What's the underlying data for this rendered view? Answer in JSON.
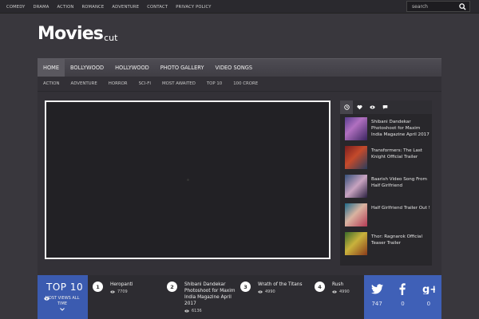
{
  "topnav": [
    "COMEDY",
    "DRAMA",
    "ACTION",
    "ROMANCE",
    "ADVENTURE",
    "CONTACT",
    "PRIVACY POLICY"
  ],
  "search": {
    "placeholder": "search"
  },
  "logo": {
    "main": "Movies",
    "sub": "cut"
  },
  "mainnav": [
    "HOME",
    "BOLLYWOOD",
    "HOLLYWOOD",
    "PHOTO GALLERY",
    "VIDEO SONGS"
  ],
  "subnav": [
    "ACTION",
    "ADVENTURE",
    "HORROR",
    "SCI-FI",
    "MOST AWAITED",
    "TOP 10",
    "100 CRORE"
  ],
  "sidebar": {
    "tabs": [
      "clock-icon",
      "heart-icon",
      "eye-icon",
      "comment-icon"
    ],
    "posts": [
      {
        "title": "Shibani Dandekar Photoshoot for Maxim India Magazine April 2017"
      },
      {
        "title": "Transformers: The Last Knight Official Trailer"
      },
      {
        "title": "Baarish Video Song From Half Girlfriend"
      },
      {
        "title": "Half Girlfriend Trailer Out !"
      },
      {
        "title": "Thor: Ragnarok Official Teaser Trailer"
      }
    ]
  },
  "top10": {
    "title": "TOP 10",
    "subtitle": "MOST VIEWS ALL TIME",
    "items": [
      {
        "rank": "1",
        "title": "Heropanti",
        "views": "7709"
      },
      {
        "rank": "2",
        "title": "Shibani Dandekar Photoshoot for Maxim India Magazine April 2017",
        "views": "6136"
      },
      {
        "rank": "3",
        "title": "Wrath of the Titans",
        "views": "4990"
      },
      {
        "rank": "4",
        "title": "Rush",
        "views": "4990"
      }
    ]
  },
  "social": [
    {
      "icon": "twitter-icon",
      "count": "747"
    },
    {
      "icon": "facebook-icon",
      "count": "0"
    },
    {
      "icon": "google-plus-icon",
      "count": "0"
    }
  ],
  "colors": {
    "accent": "#3f60b7",
    "background": "#39373d"
  }
}
